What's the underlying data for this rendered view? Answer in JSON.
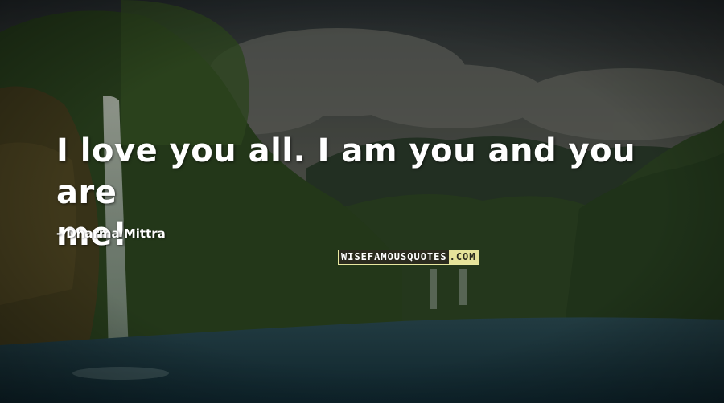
{
  "quote": {
    "line1": "I love you all. I am you and you are",
    "line2": "me!"
  },
  "author": {
    "dash": "-",
    "name": "Dharma Mittra"
  },
  "watermark": {
    "part1": "WISEFAMOUSQUOTES",
    "part2": ".COM"
  },
  "colors": {
    "text": "#ffffff",
    "sky": "#3a4448",
    "forest": "#33502a",
    "water": "#1d3c44",
    "watermark_dark": "#2b2b1e",
    "watermark_light": "#e6e39a"
  }
}
